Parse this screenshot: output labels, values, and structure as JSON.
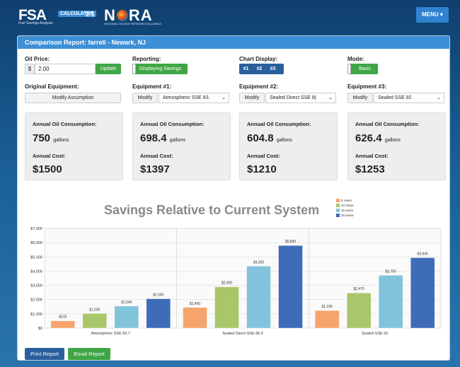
{
  "header": {
    "fsa": "FSA",
    "calc": "CALCULATOR",
    "version": "2.1",
    "fsa_sub": "Fuel Savings Analysis",
    "nora_pre": "N",
    "nora_post": "RA",
    "nora_sub": "NATIONAL OILHEAT RESEARCH ALLIANCE",
    "menu": "MENU ▾"
  },
  "report_title": "Comparison Report: farrell - Newark, NJ",
  "controls": {
    "oil_price_label": "Oil Price:",
    "currency": "$",
    "oil_price_value": "2.00",
    "update_label": "Update",
    "reporting_label": "Reporting:",
    "reporting_value": "Displaying Savings",
    "chart_display_label": "Chart Display:",
    "chart_tabs": [
      "#1",
      "#2",
      "#3"
    ],
    "mode_label": "Mode:",
    "mode_value": "Basic"
  },
  "equipment": {
    "original_label": "Original Equipment:",
    "modify_assumption": "Modify Assumption",
    "modify_label": "Modify",
    "items": [
      {
        "label": "Equipment #1:",
        "selected": "Atmospheric SSE 83."
      },
      {
        "label": "Equipment #2:",
        "selected": "Sealed Direct SSE 8("
      },
      {
        "label": "Equipment #3:",
        "selected": "Sealed SSE 92"
      }
    ]
  },
  "cards": [
    {
      "consumption_label": "Annual Oil Consumption:",
      "consumption": "750",
      "unit": "gallons",
      "cost_label": "Annual Cost:",
      "cost": "$1500"
    },
    {
      "consumption_label": "Annual Oil Consumption:",
      "consumption": "698.4",
      "unit": "gallons",
      "cost_label": "Annual Cost:",
      "cost": "$1397"
    },
    {
      "consumption_label": "Annual Oil Consumption:",
      "consumption": "604.8",
      "unit": "gallons",
      "cost_label": "Annual Cost:",
      "cost": "$1210"
    },
    {
      "consumption_label": "Annual Oil Consumption:",
      "consumption": "626.4",
      "unit": "gallons",
      "cost_label": "Annual Cost:",
      "cost": "$1253"
    }
  ],
  "chart_data": {
    "type": "bar",
    "title": "Savings Relative to Current System",
    "categories": [
      "Atmospheric SSE 83.7",
      "Sealed Direct SSE 86.5",
      "Sealed SSE 92"
    ],
    "series": [
      {
        "name": "5 Years",
        "color": "#f5a46b",
        "values": [
          515,
          1450,
          1235
        ],
        "labels": [
          "$515",
          "$1,450",
          "$1,235"
        ]
      },
      {
        "name": "10 Years",
        "color": "#a9c66a",
        "values": [
          1030,
          2900,
          2470
        ],
        "labels": [
          "$1,030",
          "$2,900",
          "$2,470"
        ]
      },
      {
        "name": "15 years",
        "color": "#82c3dc",
        "values": [
          1545,
          4350,
          3705
        ],
        "labels": [
          "$1,545",
          "$4,350",
          "$3,705"
        ]
      },
      {
        "name": "20 years",
        "color": "#3f6cb8",
        "values": [
          2060,
          5800,
          4940
        ],
        "labels": [
          "$2,060",
          "$5,800",
          "$4,940"
        ]
      }
    ],
    "ylim": [
      0,
      7000
    ],
    "yticks": [
      0,
      1000,
      2000,
      3000,
      4000,
      5000,
      6000,
      7000
    ],
    "ytick_labels": [
      "$0",
      "$1,000",
      "$2,000",
      "$3,000",
      "$4,000",
      "$5,000",
      "$6,000",
      "$7,000"
    ],
    "grid": true,
    "legend": "top-right"
  },
  "footer": {
    "print": "Print Report",
    "email": "Email Report"
  }
}
